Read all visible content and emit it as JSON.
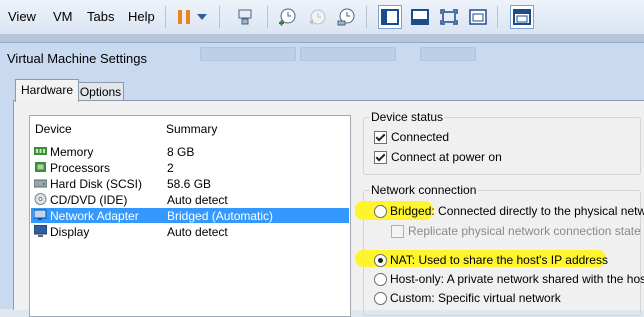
{
  "menubar": {
    "items": [
      {
        "label": "View"
      },
      {
        "label": "VM"
      },
      {
        "label": "Tabs"
      },
      {
        "label": "Help"
      }
    ]
  },
  "toolbar": {
    "icons": [
      "pause-icon",
      "dropdown-arrow-icon",
      "send-ctrl-alt-del-icon",
      "snapshot-icon",
      "revert-snapshot-icon",
      "snapshot-manager-icon",
      "console-view-icon",
      "quick-switch-icon",
      "fullscreen-icon",
      "unity-icon",
      "library-icon"
    ]
  },
  "dialog": {
    "title": "Virtual Machine Settings",
    "tabs": [
      {
        "label": "Hardware"
      },
      {
        "label": "Options"
      }
    ]
  },
  "device_table": {
    "headers": [
      "Device",
      "Summary"
    ],
    "rows": [
      {
        "icon": "memory-icon",
        "device": "Memory",
        "summary": "8 GB"
      },
      {
        "icon": "processor-icon",
        "device": "Processors",
        "summary": "2"
      },
      {
        "icon": "hard-disk-icon",
        "device": "Hard Disk (SCSI)",
        "summary": "58.6 GB"
      },
      {
        "icon": "cd-dvd-icon",
        "device": "CD/DVD (IDE)",
        "summary": "Auto detect"
      },
      {
        "icon": "network-adapter-icon",
        "device": "Network Adapter",
        "summary": "Bridged (Automatic)"
      },
      {
        "icon": "display-icon",
        "device": "Display",
        "summary": "Auto detect"
      }
    ],
    "selected_index": 4
  },
  "device_status": {
    "label": "Device status",
    "connected": {
      "label": "Connected",
      "checked": true
    },
    "connect_at_power_on": {
      "label": "Connect at power on",
      "checked": true
    }
  },
  "network_connection": {
    "label": "Network connection",
    "bridged": {
      "prefix": "Bridged:",
      "text": " Connected directly to the physical network",
      "selected": false
    },
    "replicate": {
      "label": "Replicate physical network connection state",
      "checked": false,
      "enabled": false
    },
    "nat": {
      "label": "NAT: Used to share the host's IP address",
      "selected": true
    },
    "host_only": {
      "label": "Host-only: A private network shared with the host",
      "selected": false
    },
    "custom": {
      "label": "Custom: Specific virtual network",
      "selected": false
    }
  },
  "colors": {
    "selection": "#3399ff",
    "highlight": "#fff51a",
    "pause_orange": "#e8851d"
  }
}
